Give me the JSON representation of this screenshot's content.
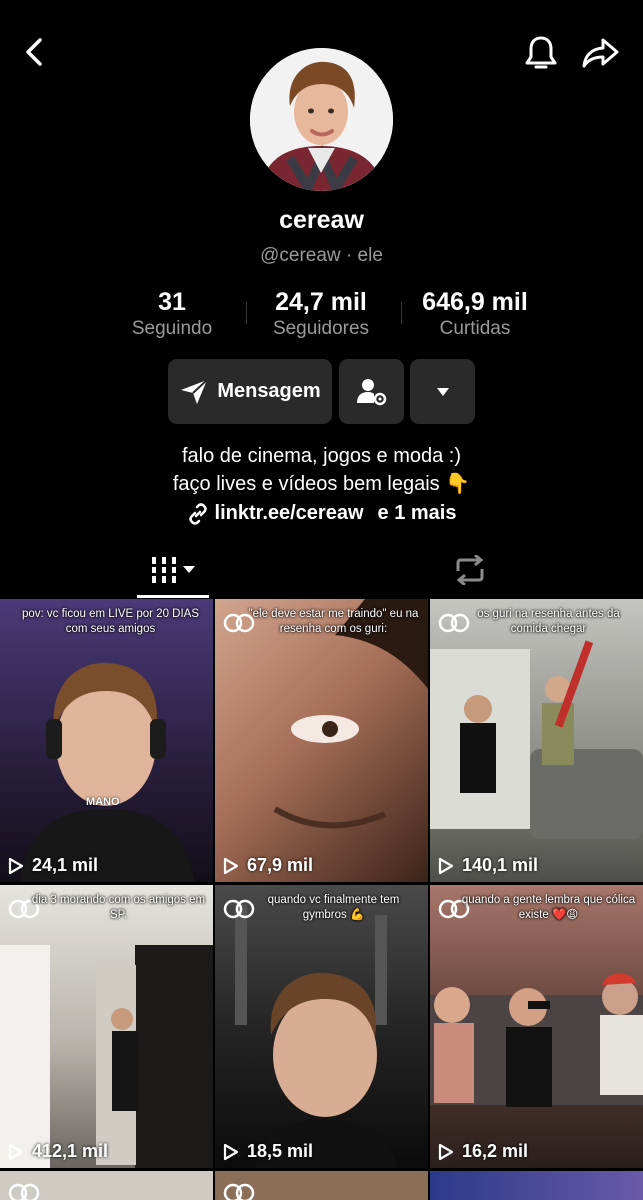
{
  "header": {
    "back_icon": "chevron-left-icon",
    "bell_icon": "bell-icon",
    "share_icon": "share-arrow-icon"
  },
  "profile": {
    "name": "cereaw",
    "handle": "@cereaw · ele",
    "stats": [
      {
        "value": "31",
        "label": "Seguindo"
      },
      {
        "value": "24,7 mil",
        "label": "Seguidores"
      },
      {
        "value": "646,9 mil",
        "label": "Curtidas"
      }
    ],
    "message_label": "Mensagem",
    "bio_line1": "falo de cinema, jogos e moda :)",
    "bio_line2": "faço lives e vídeos bem legais 👇",
    "link_text": "linktr.ee/cereaw",
    "link_extra": "e 1 mais"
  },
  "videos": [
    {
      "caption": "pov: vc ficou em LIVE por 20 DIAS com seus amigos",
      "overlay": "MANO",
      "views": "24,1 mil",
      "bg1": "#3d2f63",
      "bg2": "#14101f"
    },
    {
      "caption": "\"ele deve estar me traindo\" eu na resenha com os guri:",
      "views": "67,9 mil",
      "bg1": "#c79882",
      "bg2": "#4a2e22"
    },
    {
      "caption": "os guri na resenha antes da comida chegar",
      "views": "140,1 mil",
      "bg1": "#b9b9b4",
      "bg2": "#5a5a55"
    },
    {
      "caption": "dia 3 morando com os amigos em SP.",
      "views": "412,1 mil",
      "bg1": "#d9d7d2",
      "bg2": "#6e6a63"
    },
    {
      "caption": "quando vc finalmente tem gymbros 💪",
      "views": "18,5 mil",
      "bg1": "#3a3a3a",
      "bg2": "#0d0d0d"
    },
    {
      "caption": "quando a gente lembra que cólica existe ❤️😩",
      "views": "16,2 mil",
      "bg1": "#8c5f55",
      "bg2": "#2f2220"
    }
  ]
}
